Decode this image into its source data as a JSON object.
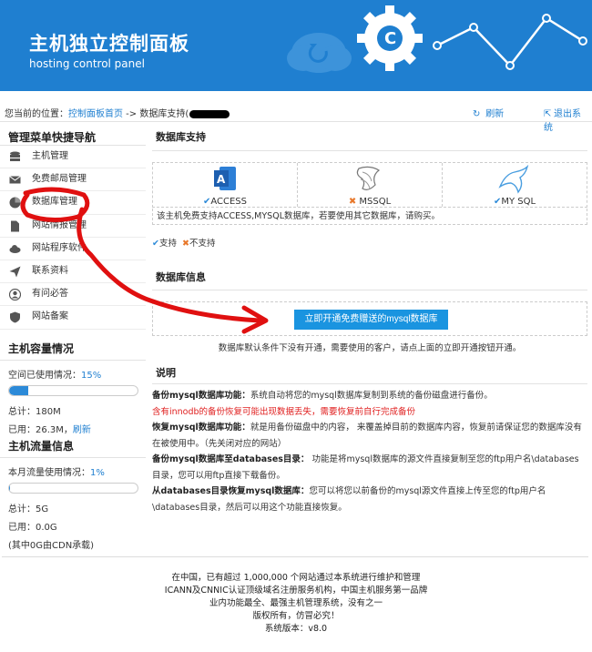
{
  "header": {
    "title": "主机独立控制面板",
    "subtitle": "hosting control panel"
  },
  "breadcrumb": {
    "prefix": "您当前的位置：",
    "home_link": "控制面板首页",
    "arrow": " -> ",
    "current": "数据库支持(",
    "refresh": "刷新",
    "logout": "退出系统"
  },
  "sidebar": {
    "title": "管理菜单快捷导航",
    "items": [
      {
        "label": "主机管理",
        "icon": "database-icon"
      },
      {
        "label": "免费邮局管理",
        "icon": "mail-icon"
      },
      {
        "label": "数据库管理",
        "icon": "pie-chart-icon"
      },
      {
        "label": "网站情报管理",
        "icon": "document-icon"
      },
      {
        "label": "网站程序软件",
        "icon": "cloud-icon"
      },
      {
        "label": "联系资料",
        "icon": "send-icon"
      },
      {
        "label": "有问必答",
        "icon": "user-icon"
      },
      {
        "label": "网站备案",
        "icon": "shield-icon"
      }
    ],
    "capacity": {
      "title": "主机容量情况",
      "used_label": "空间已使用情况：",
      "used_percent": "15%",
      "used_fraction": 0.15,
      "total": "总计：180M",
      "used": "已用：26.3M，",
      "refresh": "刷新"
    },
    "traffic": {
      "title": "主机流量信息",
      "used_label": "本月流量使用情况：",
      "used_percent": "1%",
      "used_fraction": 0.01,
      "total": "总计：5G",
      "used": "已用：0.0G",
      "cdn": "(其中0G由CDN承载)"
    }
  },
  "main": {
    "db_support_title": "数据库支持",
    "databases": [
      {
        "name": "ACCESS",
        "supported": true
      },
      {
        "name": "MSSQL",
        "supported": false
      },
      {
        "name": "MY SQL",
        "supported": true
      }
    ],
    "db_note": "该主机免费支持ACCESS,MYSQL数据库，若要使用其它数据库，请购买。",
    "legend_supported": "支持",
    "legend_unsupported": "不支持",
    "db_info_title": "数据库信息",
    "open_button": "立即开通免费赠送的mysql数据库",
    "open_desc": "数据库默认条件下没有开通，需要使用的客户，请点上面的立即开通按钮开通。",
    "explain_title": "说明",
    "explain": {
      "backup_label": "备份mysql数据库功能：",
      "backup_text": "系统自动将您的mysql数据库复制到系统的备份磁盘进行备份。",
      "warning": "含有innodb的备份恢复可能出现数据丢失，需要恢复前自行完成备份",
      "restore_label": "恢复mysql数据库功能：",
      "restore_text": "就是用备份磁盘中的内容， 来覆盖掉目前的数据库内容，恢复前请保证您的数据库没有在被使用中。（先关闭对应的网站）",
      "todir_label": "备份mysql数据库至databases目录：",
      "todir_text": " 功能是将mysql数据库的源文件直接复制至您的ftp用户名\\databases目录，您可以用ftp直接下载备份。",
      "fromdir_label": "从databases目录恢复mysql数据库：",
      "fromdir_text": "您可以将您以前备份的mysql源文件直接上传至您的ftp用户名\\databases目录，然后可以用这个功能直接恢复。"
    }
  },
  "footer": {
    "line1": "在中国，已有超过 1,000,000 个网站通过本系统进行维护和管理",
    "line2": "ICANN及CNNIC认证顶级域名注册服务机构，中国主机服务第一品牌",
    "line3": "业内功能最全、最强主机管理系统，没有之一",
    "line4": "版权所有，仿冒必究！",
    "line5": "系统版本：v8.0"
  },
  "colors": {
    "header_bg": "#1f7fd0",
    "link": "#1f7fd0",
    "button": "#1a94e0",
    "annotation": "#e01010"
  }
}
